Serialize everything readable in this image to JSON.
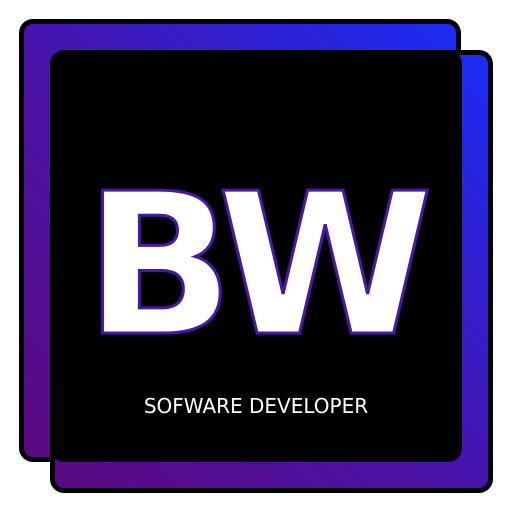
{
  "logo": {
    "monogram": "BW",
    "tagline": "SOFWARE DEVELOPER"
  },
  "colors": {
    "background": "#ffffff",
    "panel": "#000000",
    "gradient_start": "#5a0a80",
    "gradient_mid": "#4a12a6",
    "gradient_end": "#1a2cf5",
    "outline": "#000000",
    "text": "#ffffff",
    "letter_stroke": "#4b17a8"
  }
}
